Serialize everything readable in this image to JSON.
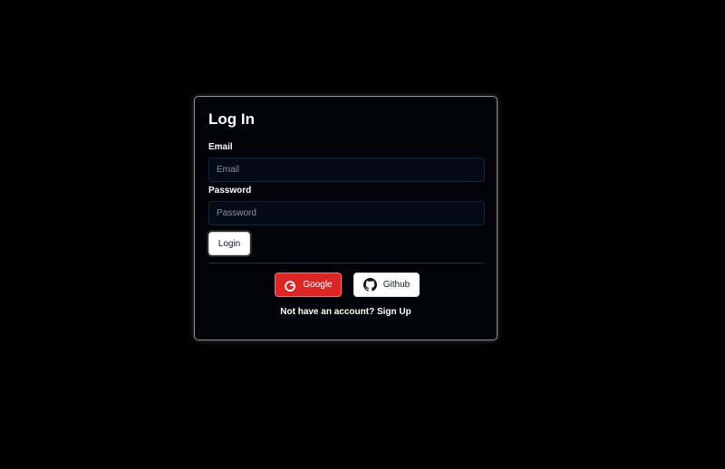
{
  "login_form": {
    "title": "Log In",
    "email_label": "Email",
    "email_placeholder": "Email",
    "email_value": "",
    "password_label": "Password",
    "password_placeholder": "Password",
    "password_value": "",
    "login_button_label": "Login"
  },
  "oauth": {
    "google_label": "Google",
    "google_icon": "google-icon",
    "google_color": "#dc2626",
    "github_label": "Github",
    "github_icon": "github-icon"
  },
  "signup": {
    "prompt": "Not have an account?",
    "link_label": "Sign Up"
  }
}
